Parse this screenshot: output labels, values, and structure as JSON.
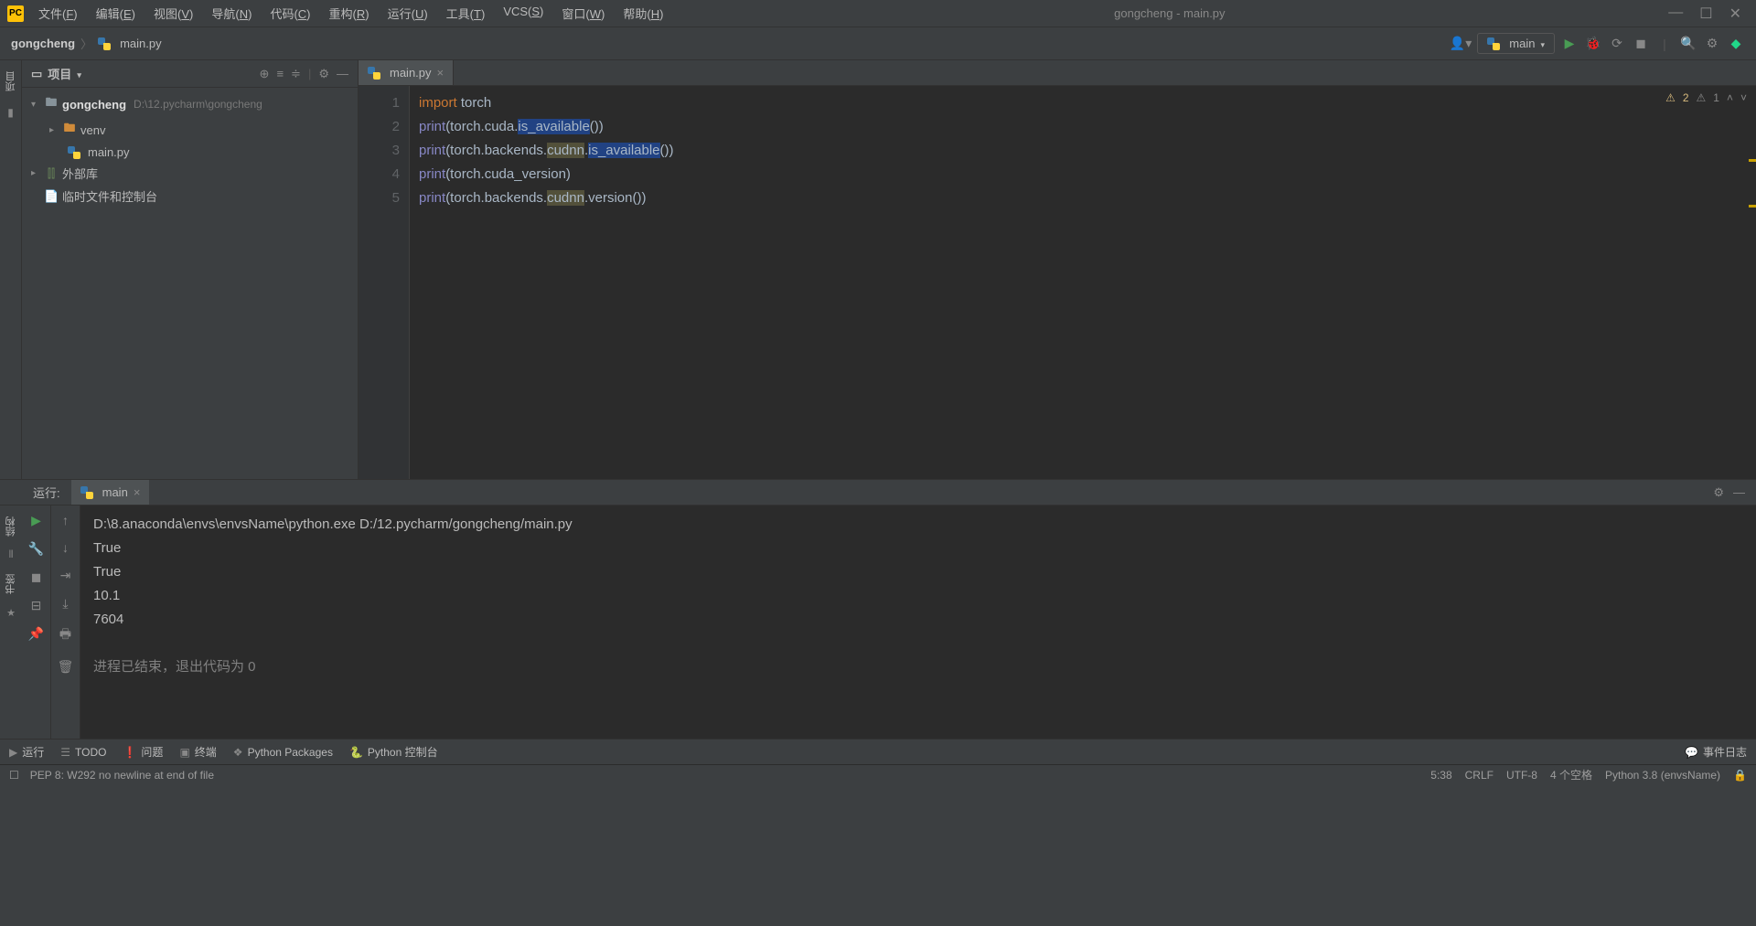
{
  "titlebar": {
    "app_title": "gongcheng - main.py",
    "menus": [
      {
        "label": "文件",
        "key": "F"
      },
      {
        "label": "编辑",
        "key": "E"
      },
      {
        "label": "视图",
        "key": "V"
      },
      {
        "label": "导航",
        "key": "N"
      },
      {
        "label": "代码",
        "key": "C"
      },
      {
        "label": "重构",
        "key": "R"
      },
      {
        "label": "运行",
        "key": "U"
      },
      {
        "label": "工具",
        "key": "T"
      },
      {
        "label": "VCS",
        "key": "S"
      },
      {
        "label": "窗口",
        "key": "W"
      },
      {
        "label": "帮助",
        "key": "H"
      }
    ]
  },
  "breadcrumb": {
    "project": "gongcheng",
    "file": "main.py"
  },
  "toolbar": {
    "run_config": "main"
  },
  "project_panel": {
    "title": "项目",
    "root": {
      "name": "gongcheng",
      "path": "D:\\12.pycharm\\gongcheng"
    },
    "venv": "venv",
    "file": "main.py",
    "ext_lib": "外部库",
    "scratch": "临时文件和控制台"
  },
  "editor": {
    "tab": "main.py",
    "line_numbers": [
      "1",
      "2",
      "3",
      "4",
      "5"
    ],
    "code_lines": [
      {
        "tokens": [
          {
            "t": "import",
            "c": "kw"
          },
          {
            "t": " torch",
            "c": "ident"
          }
        ]
      },
      {
        "tokens": [
          {
            "t": "print",
            "c": "fn"
          },
          {
            "t": "(torch.cuda.",
            "c": "ident"
          },
          {
            "t": "is_available",
            "c": "hl"
          },
          {
            "t": "())",
            "c": "ident"
          }
        ]
      },
      {
        "tokens": [
          {
            "t": "print",
            "c": "fn"
          },
          {
            "t": "(torch.backends.",
            "c": "ident"
          },
          {
            "t": "cudnn",
            "c": "warn"
          },
          {
            "t": ".",
            "c": "ident"
          },
          {
            "t": "is_available",
            "c": "hl"
          },
          {
            "t": "())",
            "c": "ident"
          }
        ]
      },
      {
        "tokens": [
          {
            "t": "print",
            "c": "fn"
          },
          {
            "t": "(torch.cuda_version)",
            "c": "ident"
          }
        ]
      },
      {
        "tokens": [
          {
            "t": "print",
            "c": "fn"
          },
          {
            "t": "(torch.backends.",
            "c": "ident"
          },
          {
            "t": "cudnn",
            "c": "warn"
          },
          {
            "t": ".version())",
            "c": "ident"
          }
        ]
      }
    ],
    "warnings": {
      "yellow": "2",
      "gray": "1"
    }
  },
  "run": {
    "label": "运行:",
    "tab": "main",
    "lines": [
      "D:\\8.anaconda\\envs\\envsName\\python.exe D:/12.pycharm/gongcheng/main.py",
      "True",
      "True",
      "10.1",
      "7604"
    ],
    "exit_msg": "进程已结束，退出代码为 0"
  },
  "bottom": {
    "run": "运行",
    "todo": "TODO",
    "problems": "问题",
    "terminal": "终端",
    "packages": "Python Packages",
    "console": "Python 控制台",
    "events": "事件日志"
  },
  "status": {
    "left_icon": "☐",
    "inspection": "PEP 8: W292 no newline at end of file",
    "pos": "5:38",
    "sep": "CRLF",
    "enc": "UTF-8",
    "indent": "4 个空格",
    "python": "Python 3.8 (envsName)"
  },
  "left_tabs": {
    "project": "项目",
    "structure": "结构",
    "bookmarks": "书签"
  }
}
